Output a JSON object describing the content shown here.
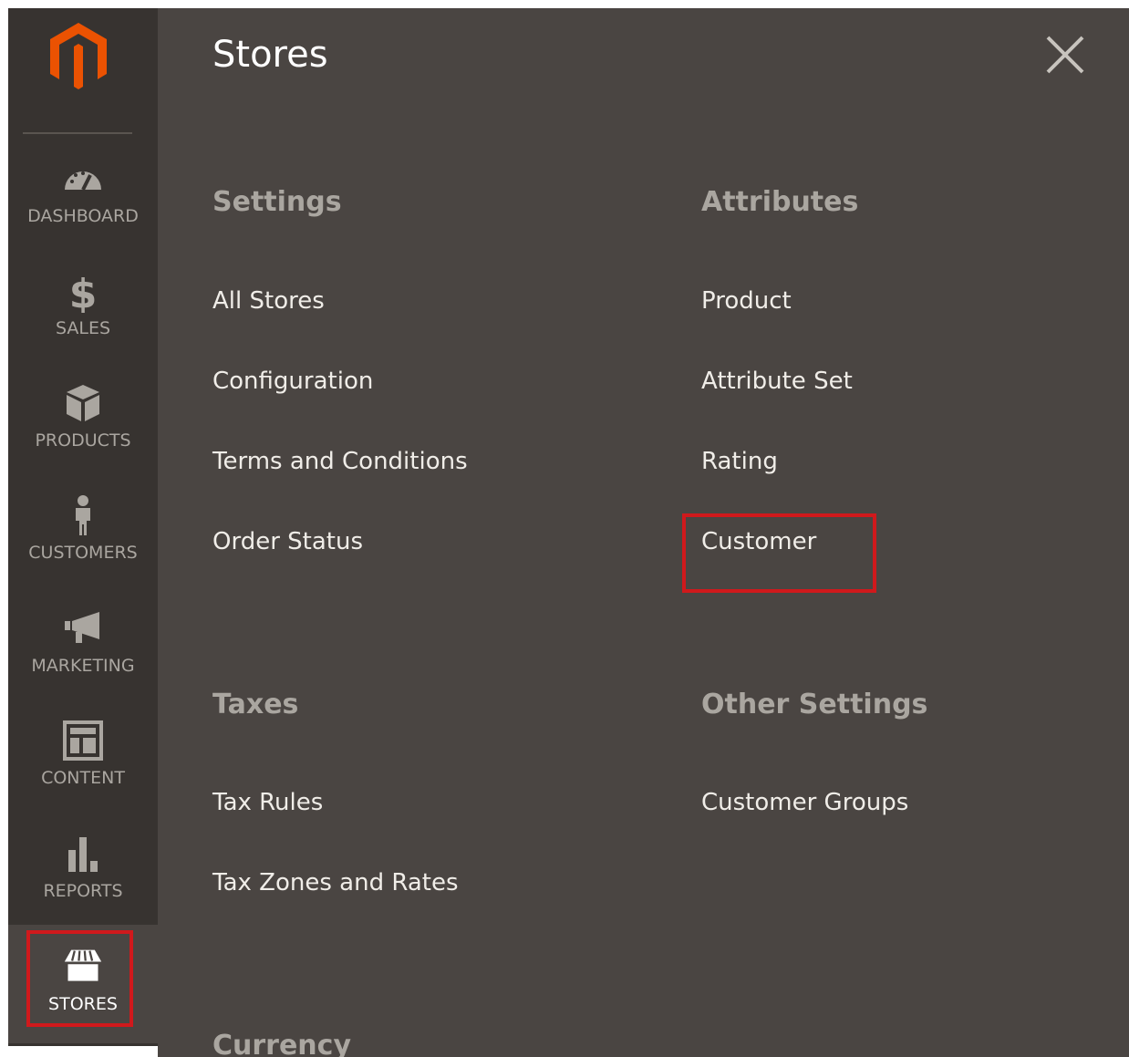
{
  "sidebar": {
    "logo_icon": "magento-logo-icon",
    "items": [
      {
        "label": "DASHBOARD",
        "icon": "gauge-icon"
      },
      {
        "label": "SALES",
        "icon": "dollar-icon"
      },
      {
        "label": "PRODUCTS",
        "icon": "box-icon"
      },
      {
        "label": "CUSTOMERS",
        "icon": "person-icon"
      },
      {
        "label": "MARKETING",
        "icon": "megaphone-icon"
      },
      {
        "label": "CONTENT",
        "icon": "layout-icon"
      },
      {
        "label": "REPORTS",
        "icon": "bar-chart-icon"
      },
      {
        "label": "STORES",
        "icon": "storefront-icon",
        "active": true
      }
    ]
  },
  "panel": {
    "title": "Stores",
    "close_icon": "close-icon",
    "sections": {
      "settings": {
        "title": "Settings",
        "links": [
          "All Stores",
          "Configuration",
          "Terms and Conditions",
          "Order Status"
        ]
      },
      "attributes": {
        "title": "Attributes",
        "links": [
          "Product",
          "Attribute Set",
          "Rating",
          "Customer"
        ]
      },
      "taxes": {
        "title": "Taxes",
        "links": [
          "Tax Rules",
          "Tax Zones and Rates"
        ]
      },
      "other_settings": {
        "title": "Other Settings",
        "links": [
          "Customer Groups"
        ]
      },
      "currency": {
        "title": "Currency"
      }
    }
  },
  "colors": {
    "sidebar_bg": "#373330",
    "panel_bg": "#4a4542",
    "logo_orange": "#eb5202",
    "highlight_red": "#d0191c",
    "section_title": "#aaa6a0",
    "link_text": "#f0ede8"
  }
}
